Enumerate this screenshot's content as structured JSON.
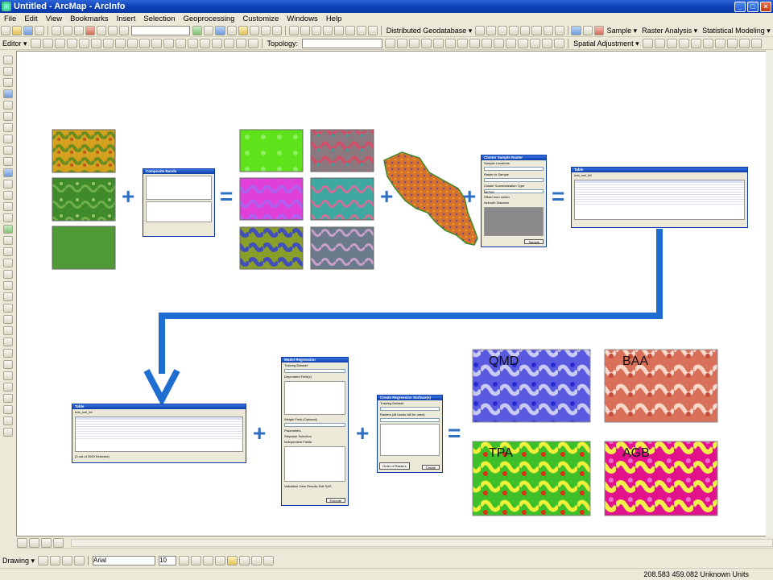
{
  "window": {
    "title": "Untitled - ArcMap - ArcInfo"
  },
  "menu": [
    "File",
    "Edit",
    "View",
    "Bookmarks",
    "Insert",
    "Selection",
    "Geoprocessing",
    "Customize",
    "Windows",
    "Help"
  ],
  "toolbars": {
    "distributed_geodatabase": "Distributed Geodatabase ▾",
    "sample": "Sample ▾",
    "raster_analysis": "Raster Analysis ▾",
    "statistical_modeling": "Statistical Modeling ▾",
    "editor": "Editor ▾",
    "topology": "Topology:",
    "spatial_adjustment": "Spatial Adjustment ▾",
    "drawing": "Drawing ▾",
    "font_name": "Arial",
    "font_size": "10"
  },
  "status": {
    "coords": "208.583  459.082 Unknown Units"
  },
  "windows": {
    "composite": {
      "title": "Composite Bands"
    },
    "cluster": {
      "title": "Cluster Sample Raster",
      "sample_locations": "Sample Locations",
      "raster_to_sample": "Raster to Sample",
      "summarization_type": "Cluster Summarization Type",
      "summarization_value": "MODE",
      "offset_label": "Offset from center",
      "azimuth": "Azimuth",
      "distance": "Distance",
      "sample_button": "Sample"
    },
    "table_top": {
      "title": "Table",
      "tab": "bob_sml_tbl"
    },
    "table_bottom": {
      "title": "Table",
      "tab": "bob_sml_tbl",
      "footer": "(0 out of 2000 Selected)"
    },
    "model_regression": {
      "title": "Model Regression",
      "training_dataset": "Training Dataset",
      "dependent_fields": "Dependent Field(s)",
      "weight_field": "Weight Field (Optional)",
      "parameters": "Parameters",
      "stepwise": "Stepwise Selection",
      "independent_fields": "Independent Fields",
      "validation": "Validation",
      "view_results": "View Results",
      "edit_sas": "Edit SAS",
      "execute": "Execute"
    },
    "create_surface": {
      "title": "Create Regression Surface(s)",
      "training_dataset": "Training Dataset",
      "rasters": "Rasters (all bands will be used)",
      "order_rasters": "Order of Rasters",
      "create": "Create"
    }
  },
  "outputs": [
    {
      "label": "QMD",
      "colors": [
        "#2b2bd6",
        "#7a7ae8",
        "#c9c9f7"
      ]
    },
    {
      "label": "BAA",
      "colors": [
        "#c54d3a",
        "#e58a74",
        "#f8d8ca"
      ]
    },
    {
      "label": "TPA",
      "colors": [
        "#3fbf2a",
        "#d92f14",
        "#eef03a"
      ]
    },
    {
      "label": "AGB",
      "colors": [
        "#e2128c",
        "#ee6ccf",
        "#f4ef48"
      ]
    }
  ],
  "operators": {
    "plus": "+",
    "equals": "="
  },
  "colors": {
    "arrow": "#1e6ed1",
    "operator": "#2c6fc3"
  }
}
